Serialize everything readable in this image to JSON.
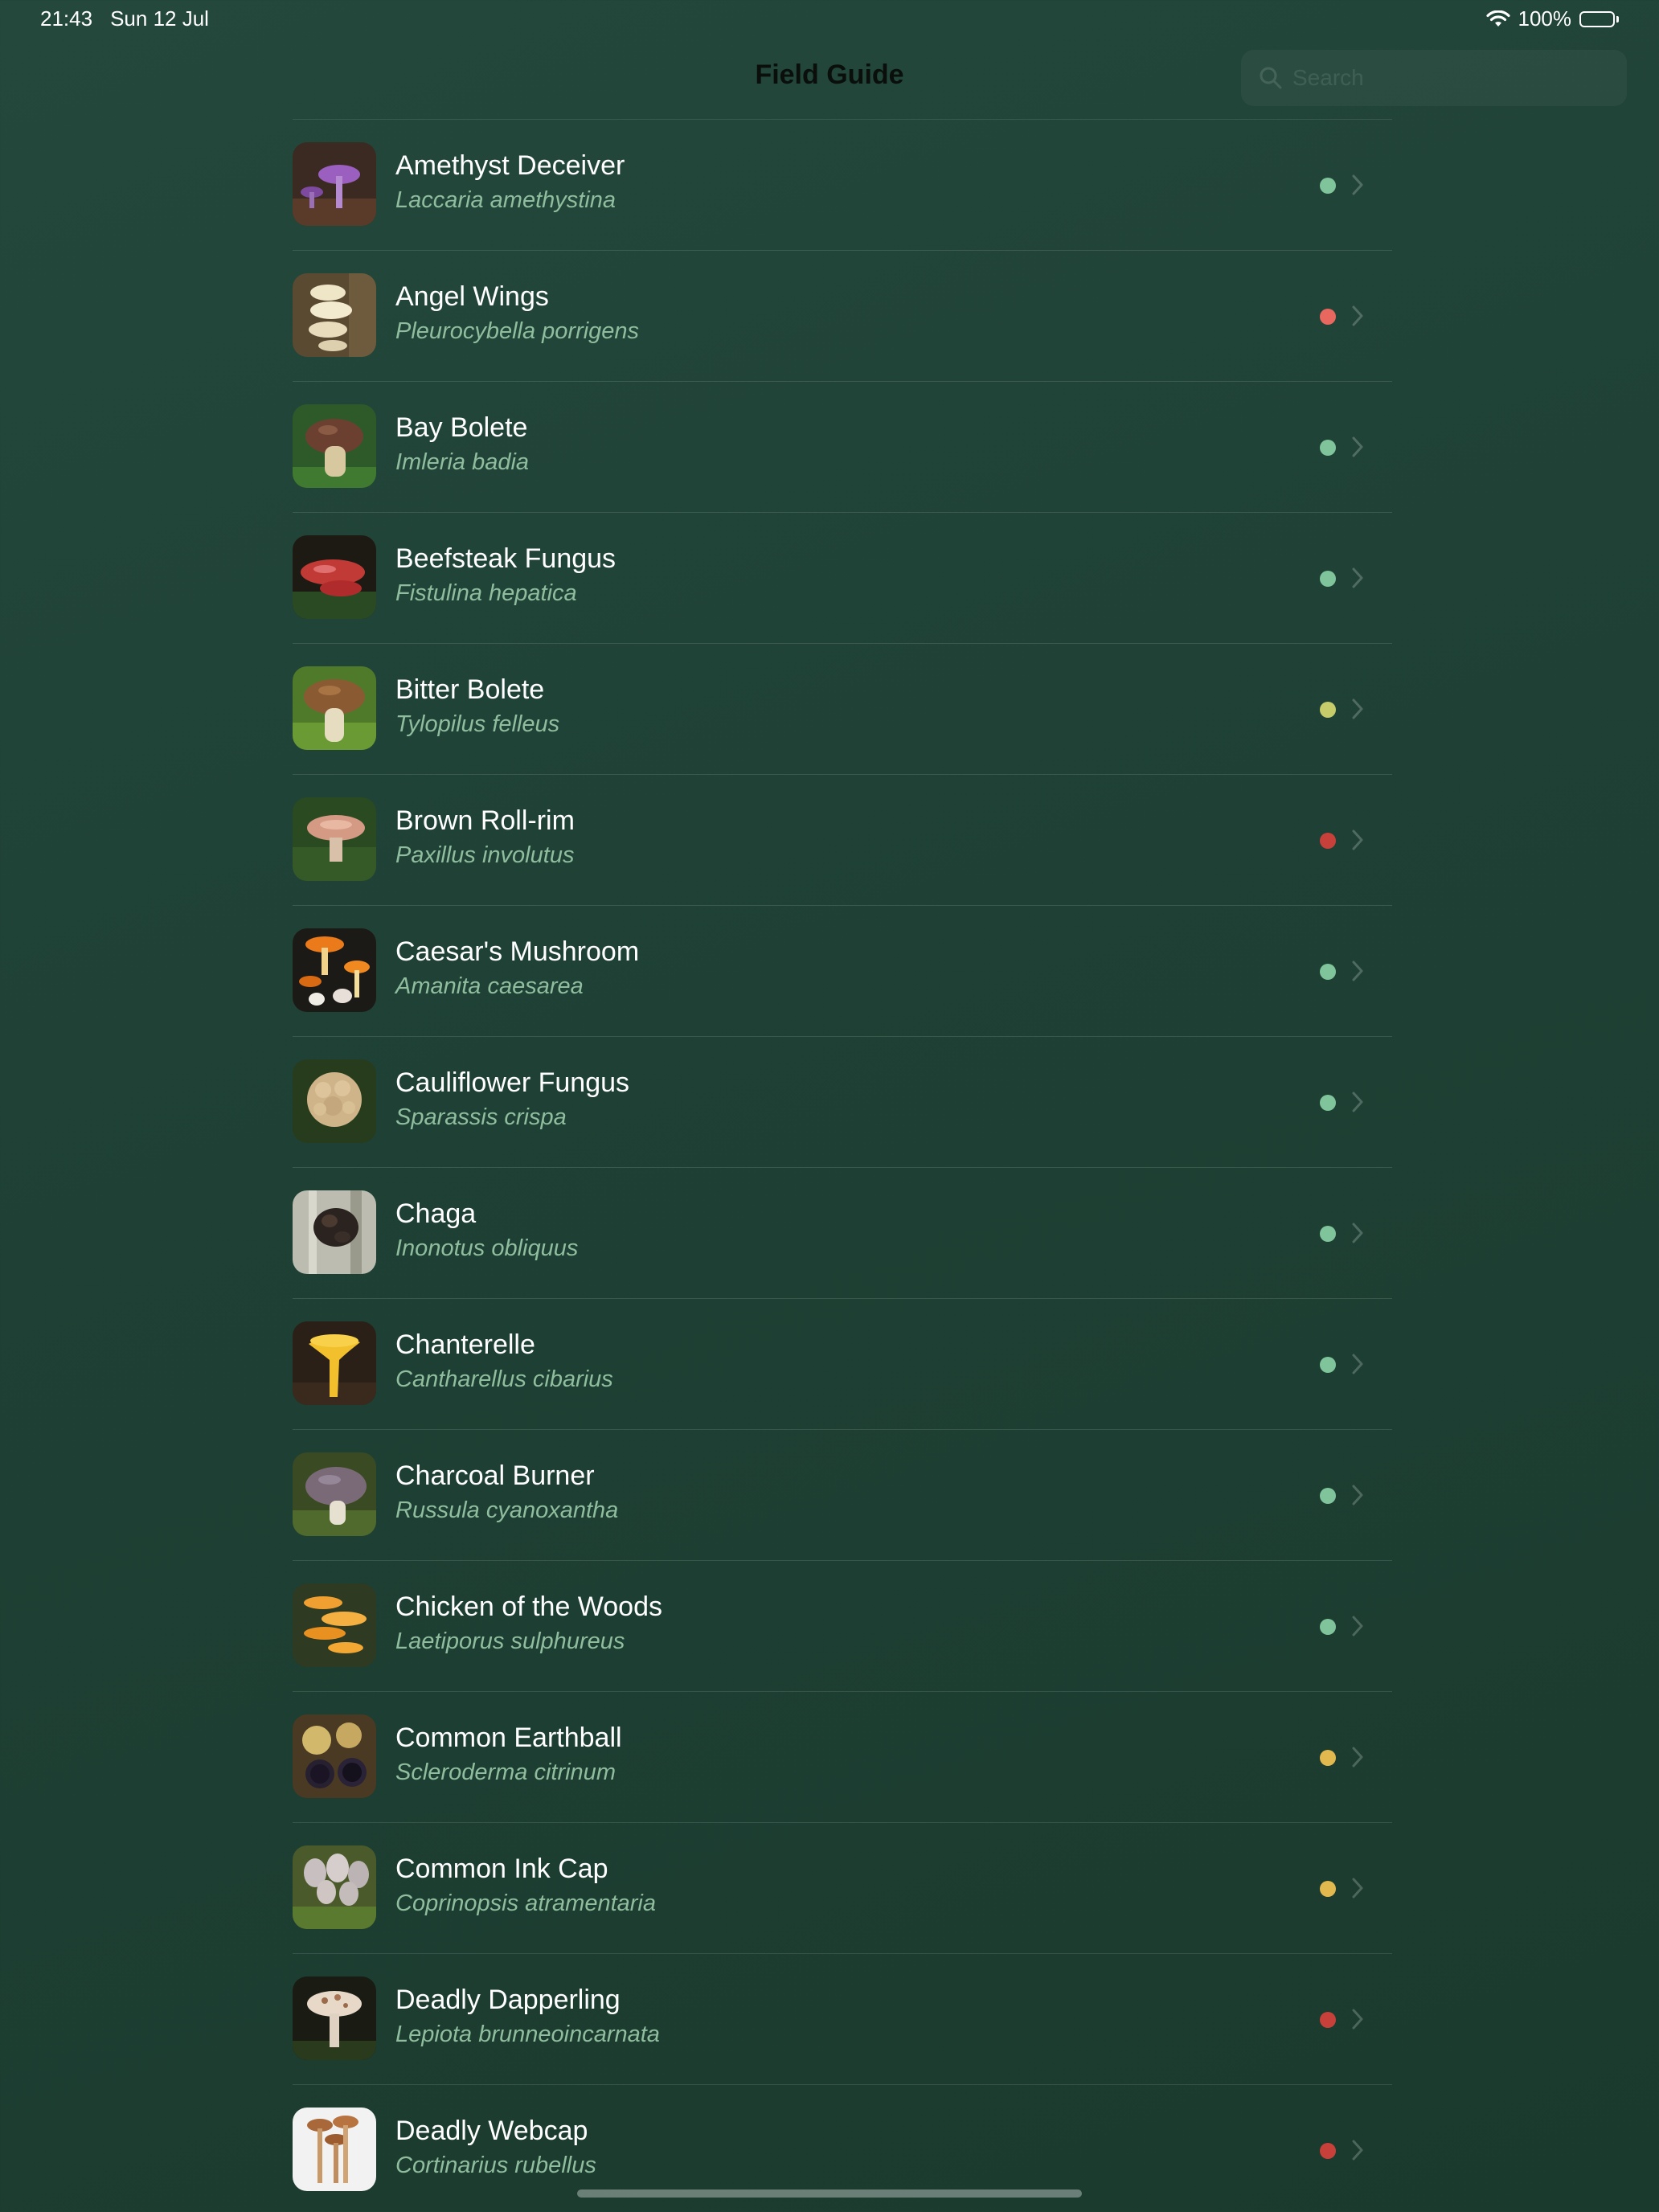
{
  "status_bar": {
    "time": "21:43",
    "date": "Sun 12 Jul",
    "battery_percent": "100%",
    "battery_level": 1.0
  },
  "nav": {
    "title": "Field Guide"
  },
  "search": {
    "placeholder": "Search"
  },
  "colors": {
    "edible": "#7fc49a",
    "poisonous_light": "#e8675e",
    "deadly": "#c8403a",
    "caution_yellowgreen": "#c6cc6a",
    "caution_yellow": "#e2b94e",
    "latin": "#8fbd9e"
  },
  "species": [
    {
      "common": "Amethyst Deceiver",
      "latin": "Laccaria amethystina",
      "status_color": "#7fc49a",
      "thumb_icon": "purple-mushroom"
    },
    {
      "common": "Angel Wings",
      "latin": "Pleurocybella porrigens",
      "status_color": "#e8675e",
      "thumb_icon": "white-bracket"
    },
    {
      "common": "Bay Bolete",
      "latin": "Imleria badia",
      "status_color": "#7fc49a",
      "thumb_icon": "brown-bolete"
    },
    {
      "common": "Beefsteak Fungus",
      "latin": "Fistulina hepatica",
      "status_color": "#7fc49a",
      "thumb_icon": "red-bracket"
    },
    {
      "common": "Bitter Bolete",
      "latin": "Tylopilus felleus",
      "status_color": "#c6cc6a",
      "thumb_icon": "tan-bolete"
    },
    {
      "common": "Brown Roll-rim",
      "latin": "Paxillus involutus",
      "status_color": "#c8403a",
      "thumb_icon": "pink-mushroom"
    },
    {
      "common": "Caesar's Mushroom",
      "latin": "Amanita caesarea",
      "status_color": "#7fc49a",
      "thumb_icon": "orange-amanita"
    },
    {
      "common": "Cauliflower Fungus",
      "latin": "Sparassis crispa",
      "status_color": "#7fc49a",
      "thumb_icon": "cauliflower-fungus"
    },
    {
      "common": "Chaga",
      "latin": "Inonotus obliquus",
      "status_color": "#7fc49a",
      "thumb_icon": "black-growth"
    },
    {
      "common": "Chanterelle",
      "latin": "Cantharellus cibarius",
      "status_color": "#7fc49a",
      "thumb_icon": "yellow-chanterelle"
    },
    {
      "common": "Charcoal Burner",
      "latin": "Russula cyanoxantha",
      "status_color": "#7fc49a",
      "thumb_icon": "grey-mushroom"
    },
    {
      "common": "Chicken of the Woods",
      "latin": "Laetiporus sulphureus",
      "status_color": "#7fc49a",
      "thumb_icon": "orange-shelf"
    },
    {
      "common": "Common Earthball",
      "latin": "Scleroderma citrinum",
      "status_color": "#e2b94e",
      "thumb_icon": "earthball"
    },
    {
      "common": "Common Ink Cap",
      "latin": "Coprinopsis atramentaria",
      "status_color": "#e2b94e",
      "thumb_icon": "ink-cap"
    },
    {
      "common": "Deadly Dapperling",
      "latin": "Lepiota brunneoincarnata",
      "status_color": "#c8403a",
      "thumb_icon": "scaly-mushroom"
    },
    {
      "common": "Deadly Webcap",
      "latin": "Cortinarius rubellus",
      "status_color": "#c8403a",
      "thumb_icon": "webcap-cluster"
    }
  ]
}
